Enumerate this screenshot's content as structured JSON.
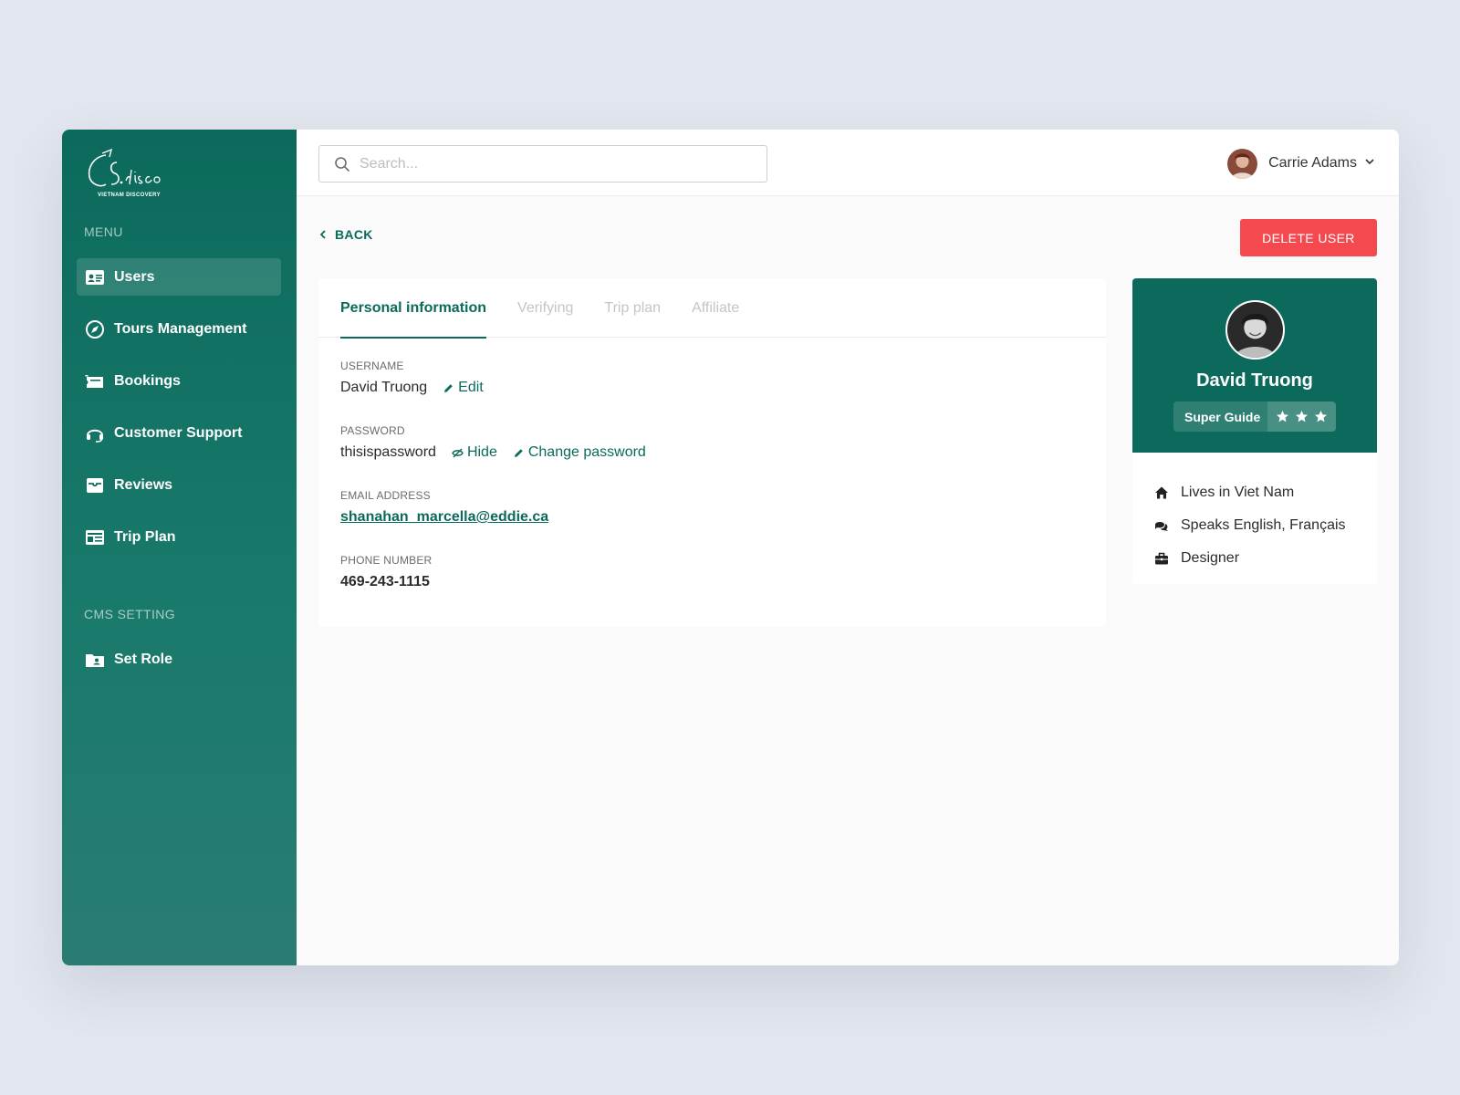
{
  "brand": {
    "logo_text": "S.disco",
    "logo_sub": "VIETNAM DISCOVERY"
  },
  "sidebar": {
    "menu_label": "MENU",
    "items": [
      {
        "label": "Users",
        "icon": "id-card-icon",
        "active": true
      },
      {
        "label": "Tours Management",
        "icon": "compass-icon"
      },
      {
        "label": "Bookings",
        "icon": "ticket-icon"
      },
      {
        "label": "Customer Support",
        "icon": "headset-icon"
      },
      {
        "label": "Reviews",
        "icon": "inbox-icon"
      },
      {
        "label": "Trip Plan",
        "icon": "newspaper-icon"
      }
    ],
    "cms_label": "CMS SETTING",
    "cms_items": [
      {
        "label": "Set Role",
        "icon": "folder-user-icon"
      }
    ]
  },
  "header": {
    "search_placeholder": "Search...",
    "user_name": "Carrie Adams"
  },
  "page": {
    "back_label": "BACK",
    "delete_label": "DELETE USER",
    "tabs": [
      {
        "label": "Personal information",
        "active": true
      },
      {
        "label": "Verifying"
      },
      {
        "label": "Trip plan"
      },
      {
        "label": "Affiliate"
      }
    ],
    "fields": {
      "username": {
        "label": "USERNAME",
        "value": "David Truong",
        "edit_label": "Edit"
      },
      "password": {
        "label": "PASSWORD",
        "value": "thisispassword",
        "hide_label": "Hide",
        "change_label": "Change password"
      },
      "email": {
        "label": "EMAIL ADDRESS",
        "value": "shanahan_marcella@eddie.ca"
      },
      "phone": {
        "label": "PHONE NUMBER",
        "value": "469-243-1115"
      }
    }
  },
  "profile": {
    "name": "David Truong",
    "badge": "Super Guide",
    "stars": 3,
    "details": [
      {
        "icon": "home-icon",
        "text": "Lives in Viet Nam"
      },
      {
        "icon": "chat-icon",
        "text": "Speaks English, Français"
      },
      {
        "icon": "briefcase-icon",
        "text": "Designer"
      }
    ]
  },
  "colors": {
    "primary": "#0b6a5b",
    "danger": "#f44a4f",
    "background": "#e2e6ee"
  }
}
